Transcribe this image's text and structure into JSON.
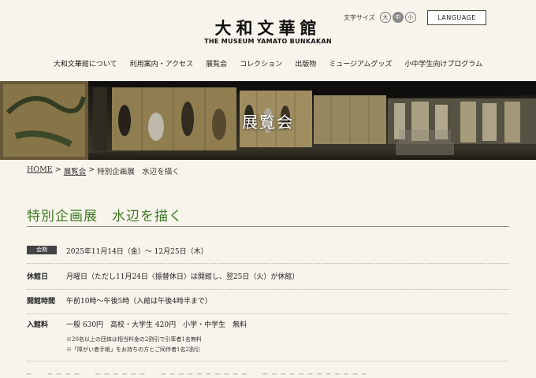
{
  "header": {
    "logo_jp": "大和文華館",
    "logo_en": "THE MUSEUM YAMATO BUNKAKAN",
    "font_size_label": "文字サイズ",
    "font_sizes": [
      "大",
      "中",
      "小"
    ],
    "font_size_selected": "中",
    "language_button": "LANGUAGE"
  },
  "nav": {
    "items": [
      "大和文華館について",
      "利用案内・アクセス",
      "展覧会",
      "コレクション",
      "出版物",
      "ミュージアムグッズ",
      "小中学生向けプログラム"
    ]
  },
  "hero": {
    "title": "展覧会"
  },
  "breadcrumb": {
    "home": "HOME",
    "sep1": ">",
    "exhibitions": "展覧会",
    "sep2": ">",
    "current": "特別企画展　水辺を描く"
  },
  "exhibition": {
    "title": "特別企画展　水辺を描く",
    "period_label": "会期",
    "period_value": "2025年11月14日（金）～ 12月25日（木）",
    "closed_label": "休館日",
    "closed_value": "月曜日（ただし11月24日〈振替休日〉は開館し、翌25日（火）が休館）",
    "hours_label": "開館時間",
    "hours_value": "午前10時～午後5時（入館は午後4時半まで）",
    "fee_label": "入館料",
    "fee_value": "一般 630円　高校・大学生 420円　小学・中学生　無料",
    "fee_note1": "※20名以上の団体は相当料金の2割引で引率者1名無料",
    "fee_note2": "※「障がい者手帳」をお持ちの方とご同伴者1名2割引"
  },
  "colors": {
    "accent_green": "#3f7a23",
    "background": "#f7f4ec",
    "badge": "#444444"
  }
}
